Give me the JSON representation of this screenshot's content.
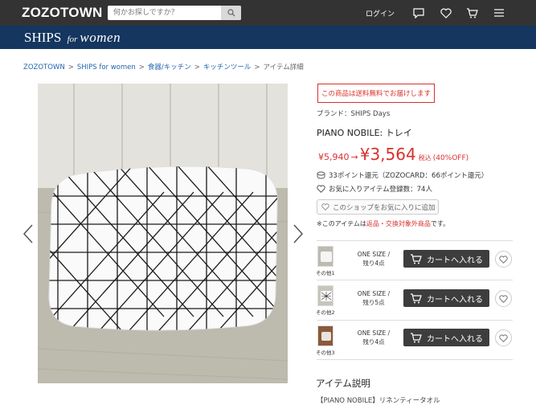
{
  "header": {
    "logo": "ZOZOTOWN",
    "search_placeholder": "何かお探しですか？",
    "login_label": "ログイン",
    "icons": [
      "search-icon",
      "chat-icon",
      "heart-icon",
      "cart-icon",
      "menu-icon"
    ]
  },
  "shop": {
    "name_main": "SHIPS",
    "name_for": "for",
    "name_women": "women"
  },
  "breadcrumb": {
    "items": [
      "ZOZOTOWN",
      "SHIPS for women",
      "食器/キッチン",
      "キッチンツール"
    ],
    "current": "アイテム詳細",
    "separator": ">"
  },
  "product": {
    "shipping_notice": "この商品は送料無料でお届けします",
    "brand_prefix": "ブランド：",
    "brand": "SHIPS Days",
    "name": "PIANO NOBILE: トレイ",
    "price_old": "¥5,940",
    "price_arrow": "→",
    "price_new": "¥3,564",
    "price_tax": "税込",
    "price_off": "(40%OFF)",
    "points": "33ポイント還元（ZOZOCARD：66ポイント還元）",
    "fav_count": "お気に入りアイテム登録数：74人",
    "shop_fav_button": "このショップをお気に入りに追加",
    "note_prefix": "※このアイテムは",
    "note_link": "返品・交換対象外商品",
    "note_suffix": "です。"
  },
  "variants": [
    {
      "label": "その他1",
      "size": "ONE SIZE /",
      "stock": "残り4点",
      "cart_label": "カートへ入れる"
    },
    {
      "label": "その他2",
      "size": "ONE SIZE /",
      "stock": "残り5点",
      "cart_label": "カートへ入れる"
    },
    {
      "label": "その他3",
      "size": "ONE SIZE /",
      "stock": "残り4点",
      "cart_label": "カートへ入れる"
    }
  ],
  "description": {
    "title": "アイテム説明",
    "text": "【PIANO NOBILE】リネンティータオル"
  },
  "colors": {
    "topbar": "#333333",
    "shopbar": "#14365f",
    "accent_red": "#d9302c",
    "link_blue": "#2365b0"
  }
}
